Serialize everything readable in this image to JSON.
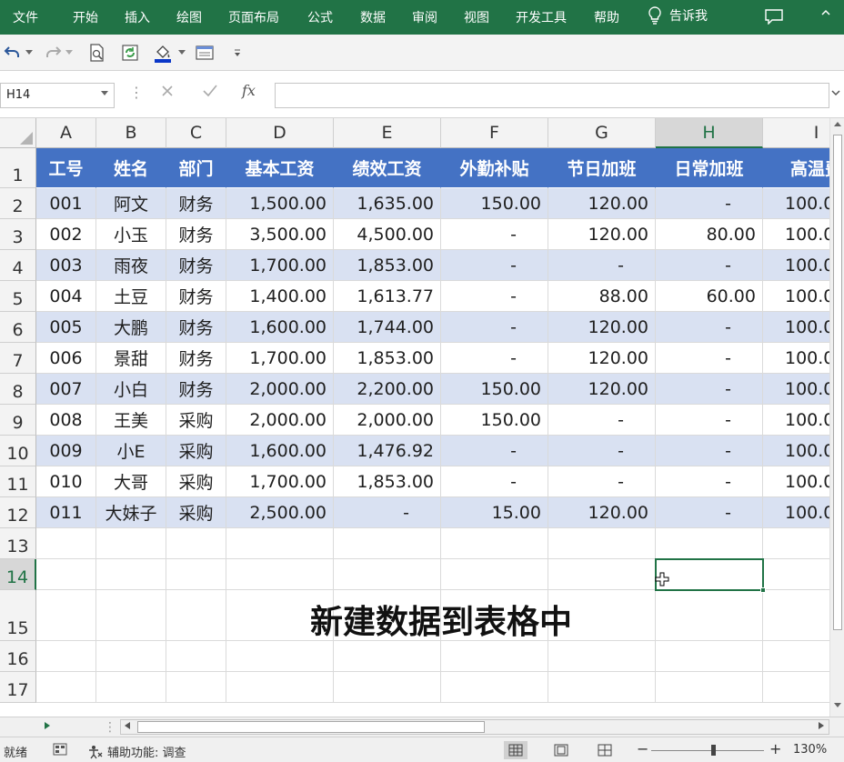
{
  "ribbon": {
    "tabs": [
      "文件",
      "开始",
      "插入",
      "绘图",
      "页面布局",
      "公式",
      "数据",
      "审阅",
      "视图",
      "开发工具",
      "帮助"
    ],
    "tell_me": "告诉我"
  },
  "namebox": {
    "value": "H14"
  },
  "formula": {
    "fx": "fx",
    "value": ""
  },
  "columns": [
    "A",
    "B",
    "C",
    "D",
    "E",
    "F",
    "G",
    "H",
    "I"
  ],
  "selected_column": "H",
  "rows": [
    "1",
    "2",
    "3",
    "4",
    "5",
    "6",
    "7",
    "8",
    "9",
    "10",
    "11",
    "12",
    "13",
    "14",
    "15",
    "16",
    "17"
  ],
  "selected_row": "14",
  "table": {
    "headers": [
      "工号",
      "姓名",
      "部门",
      "基本工资",
      "绩效工资",
      "外勤补贴",
      "节日加班",
      "日常加班",
      "高温费"
    ],
    "data": [
      [
        "001",
        "阿文",
        "财务",
        "1,500.00",
        "1,635.00",
        "150.00",
        "120.00",
        "-",
        "100.0"
      ],
      [
        "002",
        "小玉",
        "财务",
        "3,500.00",
        "4,500.00",
        "-",
        "120.00",
        "80.00",
        "100.0"
      ],
      [
        "003",
        "雨夜",
        "财务",
        "1,700.00",
        "1,853.00",
        "-",
        "-",
        "-",
        "100.0"
      ],
      [
        "004",
        "土豆",
        "财务",
        "1,400.00",
        "1,613.77",
        "-",
        "88.00",
        "60.00",
        "100.0"
      ],
      [
        "005",
        "大鹏",
        "财务",
        "1,600.00",
        "1,744.00",
        "-",
        "120.00",
        "-",
        "100.0"
      ],
      [
        "006",
        "景甜",
        "财务",
        "1,700.00",
        "1,853.00",
        "-",
        "120.00",
        "-",
        "100.0"
      ],
      [
        "007",
        "小白",
        "财务",
        "2,000.00",
        "2,200.00",
        "150.00",
        "120.00",
        "-",
        "100.0"
      ],
      [
        "008",
        "王美",
        "采购",
        "2,000.00",
        "2,000.00",
        "150.00",
        "-",
        "-",
        "100.0"
      ],
      [
        "009",
        "小E",
        "采购",
        "1,600.00",
        "1,476.92",
        "-",
        "-",
        "-",
        "100.0"
      ],
      [
        "010",
        "大哥",
        "采购",
        "1,700.00",
        "1,853.00",
        "-",
        "-",
        "-",
        "100.0"
      ],
      [
        "011",
        "大妹子",
        "采购",
        "2,500.00",
        "-",
        "15.00",
        "120.00",
        "-",
        "100.0"
      ]
    ]
  },
  "overlay_text": "新建数据到表格中",
  "status": {
    "ready": "就绪",
    "accessibility": "辅助功能: 调查",
    "zoom_minus": "−",
    "zoom_plus": "+",
    "zoom": "130%"
  },
  "colors": {
    "ribbon": "#217346",
    "table_header": "#4472c4",
    "band": "#d9e1f2"
  }
}
